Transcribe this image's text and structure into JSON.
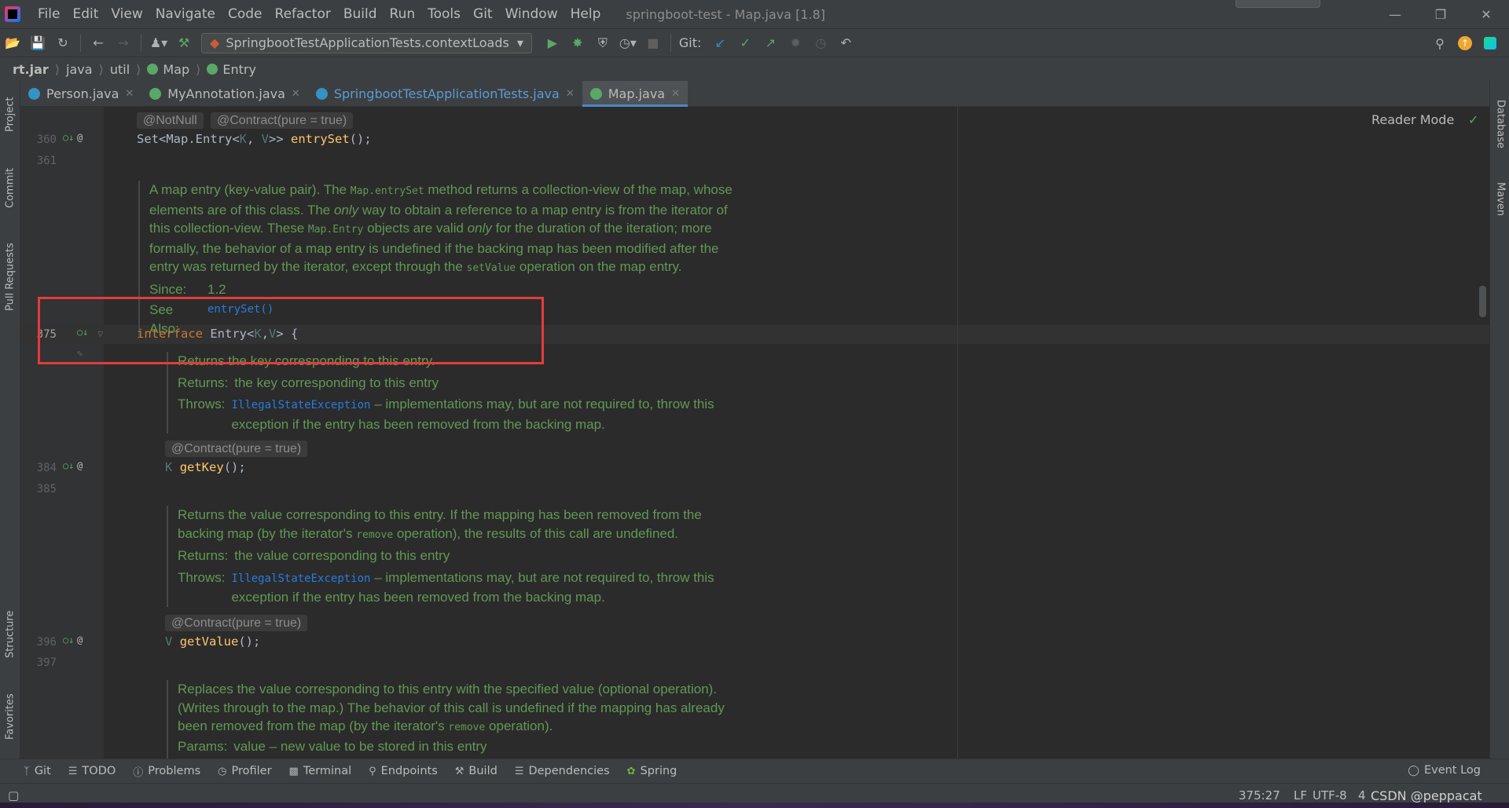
{
  "menu": {
    "items": [
      "File",
      "Edit",
      "View",
      "Navigate",
      "Code",
      "Refactor",
      "Build",
      "Run",
      "Tools",
      "Git",
      "Window",
      "Help"
    ],
    "window_title": "springboot-test - Map.java [1.8]"
  },
  "toolbar": {
    "run_config": "SpringbootTestApplicationTests.contextLoads",
    "git_label": "Git:"
  },
  "breadcrumbs": [
    "rt.jar",
    "java",
    "util",
    "Map",
    "Entry"
  ],
  "left_tools": [
    "Project",
    "Commit",
    "Pull Requests",
    "Structure",
    "Favorites"
  ],
  "right_tools": [
    "Database",
    "Maven"
  ],
  "tabs": [
    {
      "label": "Person.java",
      "color": "#3592c4"
    },
    {
      "label": "MyAnnotation.java",
      "color": "#59a869"
    },
    {
      "label": "SpringbootTestApplicationTests.java",
      "color": "#3592c4"
    },
    {
      "label": "Map.java",
      "color": "#59a869"
    }
  ],
  "editor": {
    "reader_mode": "Reader Mode",
    "inlay_notnull": "@NotNull",
    "inlay_contract": "@Contract(pure = true)",
    "line_360": "360",
    "line_361": "361",
    "line_375": "375",
    "line_384": "384",
    "line_385": "385",
    "line_396": "396",
    "line_397": "397",
    "code_360_a": "Set<Map.Entry<",
    "code_360_k": "K",
    "code_360_b": ", ",
    "code_360_v": "V",
    "code_360_c": ">> ",
    "code_360_fn": "entrySet",
    "code_360_d": "();",
    "code_375_kw": "interface",
    "code_375_a": " Entry<",
    "code_375_k": "K",
    "code_375_b": ",",
    "code_375_v": "V",
    "code_375_c": "> {",
    "code_384_t": "K",
    "code_384_fn": "getKey",
    "code_384_d": "();",
    "code_396_t": "V",
    "code_396_fn": "getValue",
    "code_396_d": "();",
    "doc1": {
      "l1a": "A map entry (key-value pair). The ",
      "l1m": "Map.entrySet",
      "l1b": " method returns a collection-view of the map, whose",
      "l2a": "elements are of this class. The ",
      "l2i": "only",
      "l2b": " way to obtain a reference to a map entry is from the iterator of",
      "l3a": "this collection-view. These ",
      "l3m": "Map.Entry",
      "l3b": " objects are valid ",
      "l3i": "only",
      "l3c": " for the duration of the iteration; more",
      "l4": "formally, the behavior of a map entry is undefined if the backing map has been modified after the",
      "l5a": "entry was returned by the iterator, except through the ",
      "l5m": "setValue",
      "l5b": " operation on the map entry.",
      "since_k": "Since:",
      "since_v": "1.2",
      "see_k": "See Also:",
      "see_v": "entrySet()"
    },
    "doc2": {
      "l1": "Returns the key corresponding to this entry.",
      "ret_k": "Returns:",
      "ret_v": "the key corresponding to this entry",
      "thr_k": "Throws:",
      "thr_x": "IllegalStateException",
      "thr_v1": " – implementations may, but are not required to, throw this",
      "thr_v2": "exception if the entry has been removed from the backing map."
    },
    "doc3": {
      "l1": "Returns the value corresponding to this entry. If the mapping has been removed from the",
      "l2a": "backing map (by the iterator's ",
      "l2m": "remove",
      "l2b": " operation), the results of this call are undefined.",
      "ret_k": "Returns:",
      "ret_v": "the value corresponding to this entry",
      "thr_k": "Throws:",
      "thr_x": "IllegalStateException",
      "thr_v1": " – implementations may, but are not required to, throw this",
      "thr_v2": "exception if the entry has been removed from the backing map."
    },
    "doc4": {
      "l1": "Replaces the value corresponding to this entry with the specified value (optional operation).",
      "l2": "(Writes through to the map.) The behavior of this call is undefined if the mapping has already",
      "l3a": "been removed from the map (by the iterator's ",
      "l3m": "remove",
      "l3b": " operation).",
      "par_k": "Params:",
      "par_v": "value – new value to be stored in this entry"
    }
  },
  "tool_windows": [
    "Git",
    "TODO",
    "Problems",
    "Profiler",
    "Terminal",
    "Endpoints",
    "Build",
    "Dependencies",
    "Spring"
  ],
  "event_log": "Event Log",
  "status": {
    "position": "375:27",
    "line_sep": "LF",
    "encoding": "UTF-8",
    "indent": "4",
    "watermark": "CSDN @peppacat"
  }
}
